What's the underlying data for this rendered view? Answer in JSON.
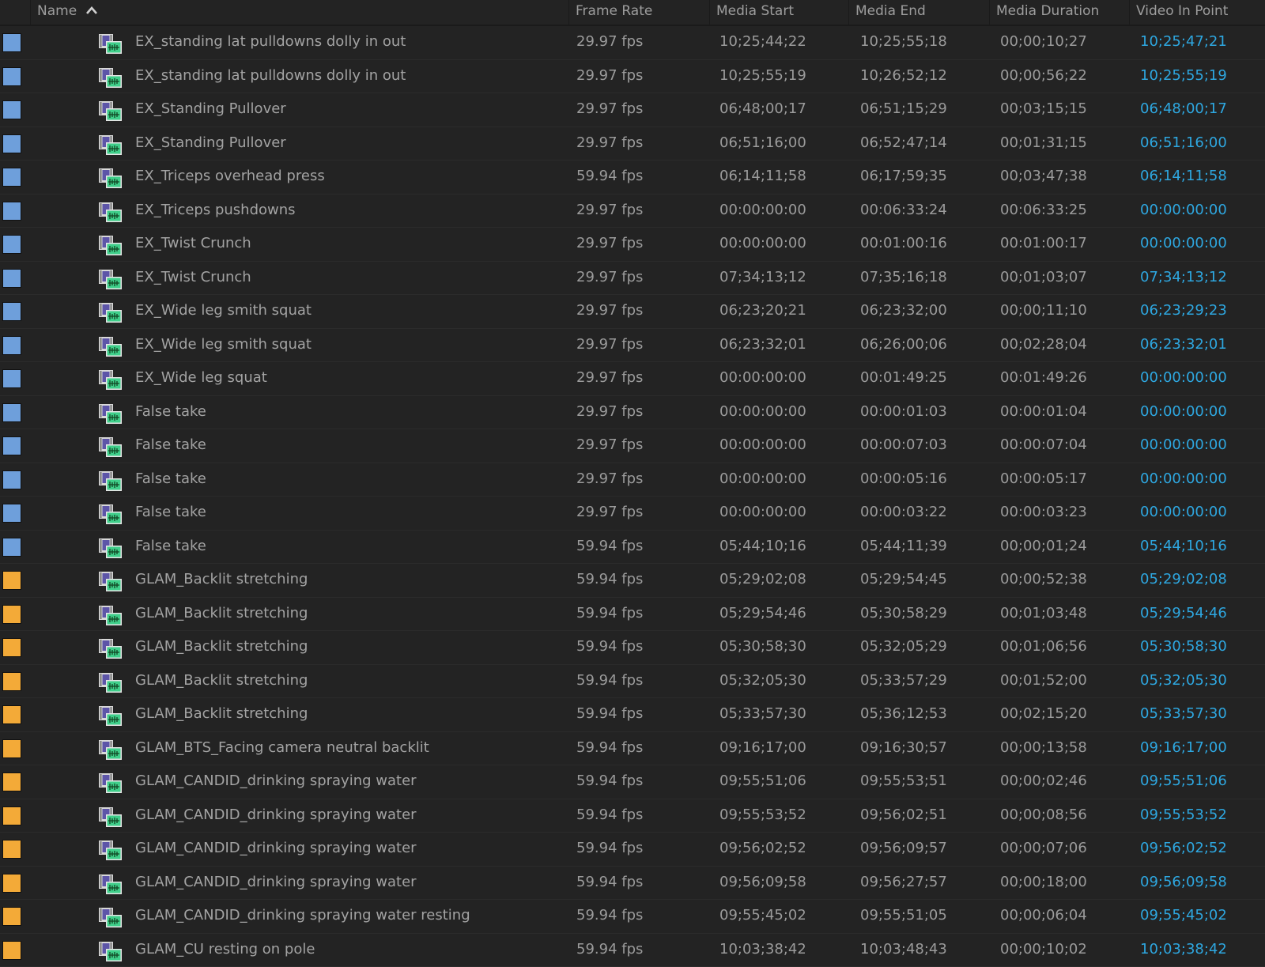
{
  "colors": {
    "label_blue": "#6e9fdb",
    "label_orange": "#f3aa38",
    "in_point": "#2ea7e0"
  },
  "columns": {
    "name": "Name",
    "frame_rate": "Frame Rate",
    "media_start": "Media Start",
    "media_end": "Media End",
    "media_duration": "Media Duration",
    "video_in_point": "Video In Point"
  },
  "sort": {
    "column": "name",
    "direction": "ascending",
    "icon": "chevron-up-icon"
  },
  "clip_icon": "video-audio-clip-icon",
  "rows": [
    {
      "label": "blue",
      "name": "EX_standing lat pulldowns dolly in out",
      "frame_rate": "29.97 fps",
      "media_start": "10;25;44;22",
      "media_end": "10;25;55;18",
      "media_duration": "00;00;10;27",
      "video_in_point": "10;25;47;21"
    },
    {
      "label": "blue",
      "name": "EX_standing lat pulldowns dolly in out",
      "frame_rate": "29.97 fps",
      "media_start": "10;25;55;19",
      "media_end": "10;26;52;12",
      "media_duration": "00;00;56;22",
      "video_in_point": "10;25;55;19"
    },
    {
      "label": "blue",
      "name": "EX_Standing Pullover",
      "frame_rate": "29.97 fps",
      "media_start": "06;48;00;17",
      "media_end": "06;51;15;29",
      "media_duration": "00;03;15;15",
      "video_in_point": "06;48;00;17"
    },
    {
      "label": "blue",
      "name": "EX_Standing Pullover",
      "frame_rate": "29.97 fps",
      "media_start": "06;51;16;00",
      "media_end": "06;52;47;14",
      "media_duration": "00;01;31;15",
      "video_in_point": "06;51;16;00"
    },
    {
      "label": "blue",
      "name": "EX_Triceps overhead press",
      "frame_rate": "59.94 fps",
      "media_start": "06;14;11;58",
      "media_end": "06;17;59;35",
      "media_duration": "00;03;47;38",
      "video_in_point": "06;14;11;58"
    },
    {
      "label": "blue",
      "name": "EX_Triceps pushdowns",
      "frame_rate": "29.97 fps",
      "media_start": "00:00:00:00",
      "media_end": "00:06:33:24",
      "media_duration": "00:06:33:25",
      "video_in_point": "00:00:00:00"
    },
    {
      "label": "blue",
      "name": "EX_Twist Crunch",
      "frame_rate": "29.97 fps",
      "media_start": "00:00:00:00",
      "media_end": "00:01:00:16",
      "media_duration": "00:01:00:17",
      "video_in_point": "00:00:00:00"
    },
    {
      "label": "blue",
      "name": "EX_Twist Crunch",
      "frame_rate": "29.97 fps",
      "media_start": "07;34;13;12",
      "media_end": "07;35;16;18",
      "media_duration": "00;01;03;07",
      "video_in_point": "07;34;13;12"
    },
    {
      "label": "blue",
      "name": "EX_Wide leg smith squat",
      "frame_rate": "29.97 fps",
      "media_start": "06;23;20;21",
      "media_end": "06;23;32;00",
      "media_duration": "00;00;11;10",
      "video_in_point": "06;23;29;23"
    },
    {
      "label": "blue",
      "name": "EX_Wide leg smith squat",
      "frame_rate": "29.97 fps",
      "media_start": "06;23;32;01",
      "media_end": "06;26;00;06",
      "media_duration": "00;02;28;04",
      "video_in_point": "06;23;32;01"
    },
    {
      "label": "blue",
      "name": "EX_Wide leg squat",
      "frame_rate": "29.97 fps",
      "media_start": "00:00:00:00",
      "media_end": "00:01:49:25",
      "media_duration": "00:01:49:26",
      "video_in_point": "00:00:00:00"
    },
    {
      "label": "blue",
      "name": "False take",
      "frame_rate": "29.97 fps",
      "media_start": "00:00:00:00",
      "media_end": "00:00:01:03",
      "media_duration": "00:00:01:04",
      "video_in_point": "00:00:00:00"
    },
    {
      "label": "blue",
      "name": "False take",
      "frame_rate": "29.97 fps",
      "media_start": "00:00:00:00",
      "media_end": "00:00:07:03",
      "media_duration": "00:00:07:04",
      "video_in_point": "00:00:00:00"
    },
    {
      "label": "blue",
      "name": "False take",
      "frame_rate": "29.97 fps",
      "media_start": "00:00:00:00",
      "media_end": "00:00:05:16",
      "media_duration": "00:00:05:17",
      "video_in_point": "00:00:00:00"
    },
    {
      "label": "blue",
      "name": "False take",
      "frame_rate": "29.97 fps",
      "media_start": "00:00:00:00",
      "media_end": "00:00:03:22",
      "media_duration": "00:00:03:23",
      "video_in_point": "00:00:00:00"
    },
    {
      "label": "blue",
      "name": "False take",
      "frame_rate": "59.94 fps",
      "media_start": "05;44;10;16",
      "media_end": "05;44;11;39",
      "media_duration": "00;00;01;24",
      "video_in_point": "05;44;10;16"
    },
    {
      "label": "orange",
      "name": "GLAM_Backlit stretching",
      "frame_rate": "59.94 fps",
      "media_start": "05;29;02;08",
      "media_end": "05;29;54;45",
      "media_duration": "00;00;52;38",
      "video_in_point": "05;29;02;08"
    },
    {
      "label": "orange",
      "name": "GLAM_Backlit stretching",
      "frame_rate": "59.94 fps",
      "media_start": "05;29;54;46",
      "media_end": "05;30;58;29",
      "media_duration": "00;01;03;48",
      "video_in_point": "05;29;54;46"
    },
    {
      "label": "orange",
      "name": "GLAM_Backlit stretching",
      "frame_rate": "59.94 fps",
      "media_start": "05;30;58;30",
      "media_end": "05;32;05;29",
      "media_duration": "00;01;06;56",
      "video_in_point": "05;30;58;30"
    },
    {
      "label": "orange",
      "name": "GLAM_Backlit stretching",
      "frame_rate": "59.94 fps",
      "media_start": "05;32;05;30",
      "media_end": "05;33;57;29",
      "media_duration": "00;01;52;00",
      "video_in_point": "05;32;05;30"
    },
    {
      "label": "orange",
      "name": "GLAM_Backlit stretching",
      "frame_rate": "59.94 fps",
      "media_start": "05;33;57;30",
      "media_end": "05;36;12;53",
      "media_duration": "00;02;15;20",
      "video_in_point": "05;33;57;30"
    },
    {
      "label": "orange",
      "name": "GLAM_BTS_Facing camera neutral backlit",
      "frame_rate": "59.94 fps",
      "media_start": "09;16;17;00",
      "media_end": "09;16;30;57",
      "media_duration": "00;00;13;58",
      "video_in_point": "09;16;17;00"
    },
    {
      "label": "orange",
      "name": "GLAM_CANDID_drinking spraying water",
      "frame_rate": "59.94 fps",
      "media_start": "09;55;51;06",
      "media_end": "09;55;53;51",
      "media_duration": "00;00;02;46",
      "video_in_point": "09;55;51;06"
    },
    {
      "label": "orange",
      "name": "GLAM_CANDID_drinking spraying water",
      "frame_rate": "59.94 fps",
      "media_start": "09;55;53;52",
      "media_end": "09;56;02;51",
      "media_duration": "00;00;08;56",
      "video_in_point": "09;55;53;52"
    },
    {
      "label": "orange",
      "name": "GLAM_CANDID_drinking spraying water",
      "frame_rate": "59.94 fps",
      "media_start": "09;56;02;52",
      "media_end": "09;56;09;57",
      "media_duration": "00;00;07;06",
      "video_in_point": "09;56;02;52"
    },
    {
      "label": "orange",
      "name": "GLAM_CANDID_drinking spraying water",
      "frame_rate": "59.94 fps",
      "media_start": "09;56;09;58",
      "media_end": "09;56;27;57",
      "media_duration": "00;00;18;00",
      "video_in_point": "09;56;09;58"
    },
    {
      "label": "orange",
      "name": "GLAM_CANDID_drinking spraying water resting",
      "frame_rate": "59.94 fps",
      "media_start": "09;55;45;02",
      "media_end": "09;55;51;05",
      "media_duration": "00;00;06;04",
      "video_in_point": "09;55;45;02"
    },
    {
      "label": "orange",
      "name": "GLAM_CU resting on pole",
      "frame_rate": "59.94 fps",
      "media_start": "10;03;38;42",
      "media_end": "10;03;48;43",
      "media_duration": "00;00;10;02",
      "video_in_point": "10;03;38;42"
    }
  ]
}
